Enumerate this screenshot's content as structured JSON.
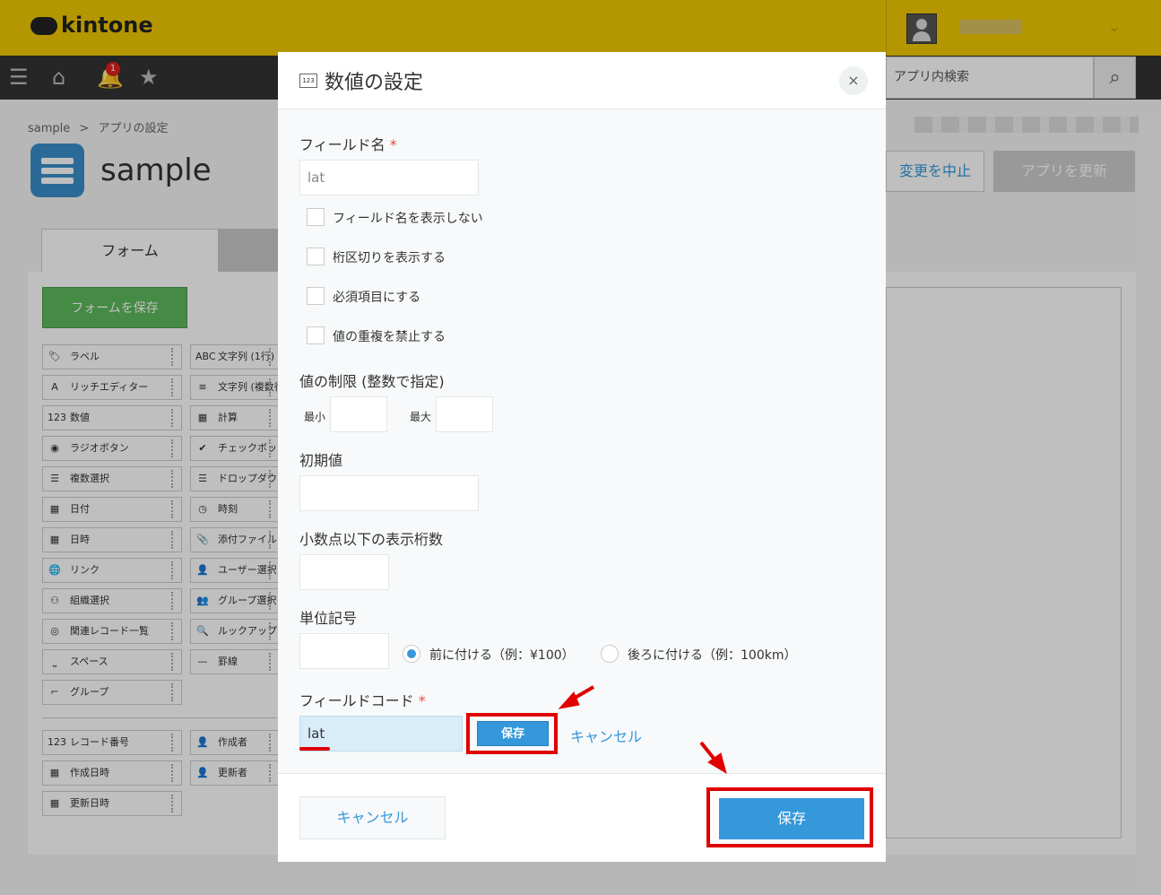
{
  "header": {
    "logo": "kintone",
    "search_placeholder": "アプリ内検索",
    "notification_count": "1"
  },
  "page": {
    "breadcrumb": [
      "sample",
      ">",
      "アプリの設定"
    ],
    "app_title": "sample",
    "cancel_change": "変更を中止",
    "update_app": "アプリを更新",
    "tab_form": "フォーム",
    "save_form": "フォームを保存"
  },
  "palette": {
    "col1": [
      {
        "icon": "🏷",
        "label": "ラベル"
      },
      {
        "icon": "A",
        "label": "リッチエディター"
      },
      {
        "icon": "123",
        "label": "数値"
      },
      {
        "icon": "◉",
        "label": "ラジオボタン"
      },
      {
        "icon": "☰",
        "label": "複数選択"
      },
      {
        "icon": "▦",
        "label": "日付"
      },
      {
        "icon": "▦",
        "label": "日時"
      },
      {
        "icon": "🌐",
        "label": "リンク"
      },
      {
        "icon": "⚇",
        "label": "組織選択"
      },
      {
        "icon": "◎",
        "label": "関連レコード一覧"
      },
      {
        "icon": "⎵",
        "label": "スペース"
      },
      {
        "icon": "⌐",
        "label": "グループ"
      }
    ],
    "col2": [
      {
        "icon": "ABC",
        "label": "文字列 (1行)"
      },
      {
        "icon": "≡",
        "label": "文字列 (複数行)"
      },
      {
        "icon": "▦",
        "label": "計算"
      },
      {
        "icon": "✔",
        "label": "チェックボックス"
      },
      {
        "icon": "☰",
        "label": "ドロップダウン"
      },
      {
        "icon": "◷",
        "label": "時刻"
      },
      {
        "icon": "📎",
        "label": "添付ファイル"
      },
      {
        "icon": "👤",
        "label": "ユーザー選択"
      },
      {
        "icon": "👥",
        "label": "グループ選択"
      },
      {
        "icon": "🔍",
        "label": "ルックアップ"
      },
      {
        "icon": "—",
        "label": "罫線"
      }
    ],
    "system1": [
      {
        "icon": "123",
        "label": "レコード番号"
      },
      {
        "icon": "▦",
        "label": "作成日時"
      },
      {
        "icon": "▦",
        "label": "更新日時"
      }
    ],
    "system2": [
      {
        "icon": "👤",
        "label": "作成者"
      },
      {
        "icon": "👤",
        "label": "更新者"
      }
    ]
  },
  "dialog": {
    "title": "数値の設定",
    "field_name_label": "フィールド名",
    "required_mark": "*",
    "field_name_placeholder": "lat",
    "checkboxes": [
      "フィールド名を表示しない",
      "桁区切りを表示する",
      "必須項目にする",
      "値の重複を禁止する"
    ],
    "limit_label": "値の制限 (整数で指定)",
    "min_label": "最小",
    "max_label": "最大",
    "default_label": "初期値",
    "decimal_label": "小数点以下の表示桁数",
    "unit_label": "単位記号",
    "unit_before": "前に付ける（例：¥100）",
    "unit_after": "後ろに付ける（例：100km）",
    "field_code_label": "フィールドコード",
    "field_code_value": "lat",
    "code_save": "保存",
    "code_cancel": "キャンセル",
    "footer_cancel": "キャンセル",
    "footer_save": "保存"
  }
}
